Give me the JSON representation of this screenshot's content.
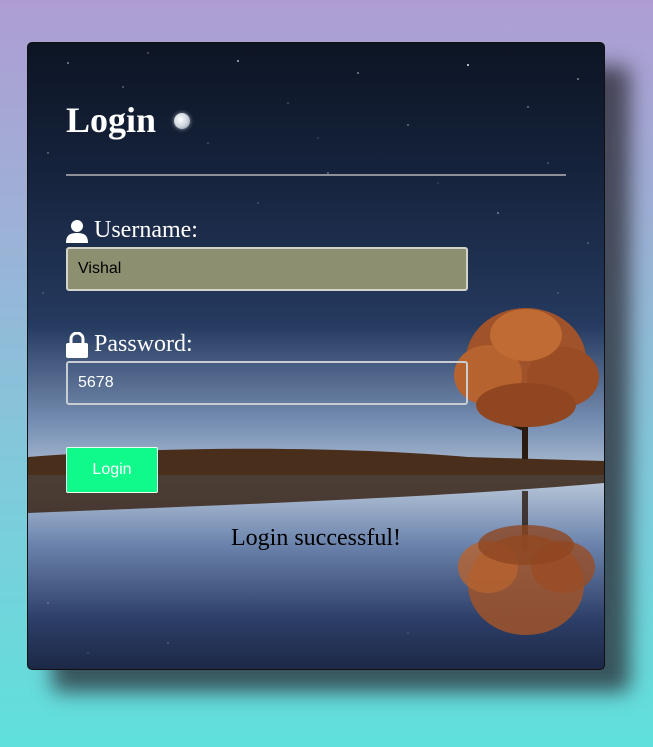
{
  "login": {
    "title": "Login",
    "username_label": "Username:",
    "username_value": "Vishal",
    "password_label": "Password:",
    "password_value": "5678",
    "button_label": "Login",
    "status_message": "Login successful!"
  },
  "colors": {
    "button": "#0ffa8a",
    "username_bg": "#8d9070",
    "title": "#ffffff"
  },
  "icons": {
    "title_icon": "moon-icon",
    "username_icon": "user-icon",
    "password_icon": "lock-icon"
  }
}
